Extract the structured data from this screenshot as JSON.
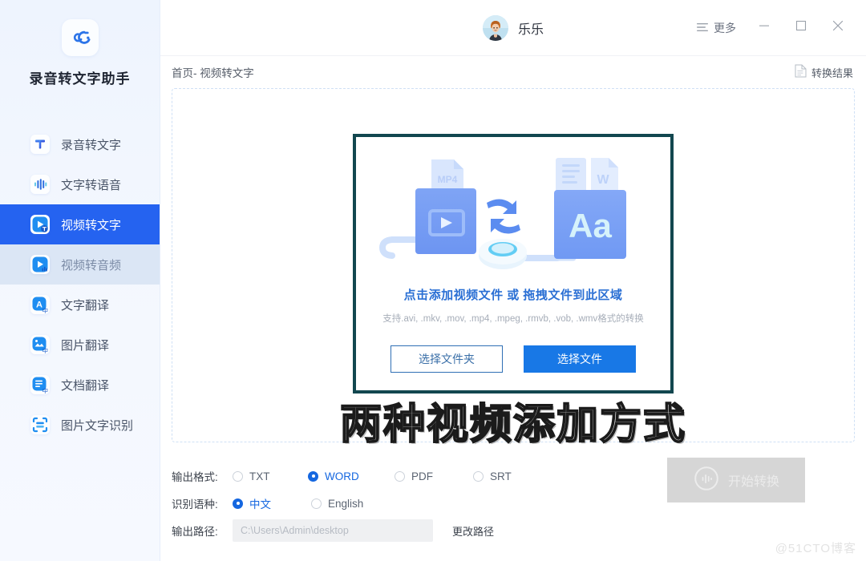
{
  "app": {
    "brand_name": "录音转文字助手",
    "logo_icon": "app-logo-icon"
  },
  "sidebar": {
    "items": [
      {
        "label": "录音转文字",
        "icon": "audio-to-text-icon",
        "state": "normal"
      },
      {
        "label": "文字转语音",
        "icon": "text-to-speech-icon",
        "state": "normal"
      },
      {
        "label": "视频转文字",
        "icon": "video-to-text-icon",
        "state": "selected"
      },
      {
        "label": "视频转音频",
        "icon": "video-to-audio-icon",
        "state": "hovered"
      },
      {
        "label": "文字翻译",
        "icon": "text-translate-icon",
        "state": "normal"
      },
      {
        "label": "图片翻译",
        "icon": "image-translate-icon",
        "state": "normal"
      },
      {
        "label": "文档翻译",
        "icon": "doc-translate-icon",
        "state": "normal"
      },
      {
        "label": "图片文字识别",
        "icon": "ocr-icon",
        "state": "normal"
      }
    ]
  },
  "titlebar": {
    "user_name": "乐乐",
    "more_label": "更多",
    "more_icon": "hamburger-icon",
    "minimize_icon": "minimize-icon",
    "maximize_icon": "maximize-icon",
    "close_icon": "close-icon"
  },
  "breadcrumb": {
    "text": "首页- 视频转文字",
    "result_label": "转换结果",
    "result_icon": "document-icon"
  },
  "dropzone": {
    "title": "点击添加视频文件 或 拖拽文件到此区域",
    "subtitle": "支持.avi, .mkv, .mov, .mp4, .mpeg, .rmvb, .vob, .wmv格式的转换",
    "folder_button": "选择文件夹",
    "file_button": "选择文件",
    "illustration_icon": "video-to-text-illustration",
    "source_file_label": "MP4",
    "target_text_label": "Aa",
    "target_doc_label": "W"
  },
  "overlay_caption": "两种视频添加方式",
  "form": {
    "format_label": "输出格式:",
    "format_options": [
      {
        "label": "TXT",
        "selected": false
      },
      {
        "label": "WORD",
        "selected": true
      },
      {
        "label": "PDF",
        "selected": false
      },
      {
        "label": "SRT",
        "selected": false
      }
    ],
    "language_label": "识别语种:",
    "language_options": [
      {
        "label": "中文",
        "selected": true
      },
      {
        "label": "English",
        "selected": false
      }
    ],
    "path_label": "输出路径:",
    "path_placeholder": "C:\\Users\\Admin\\desktop",
    "path_value": "",
    "change_path_label": "更改路径"
  },
  "start_button": {
    "label": "开始转换",
    "icon": "waveform-circle-icon",
    "disabled": true
  },
  "watermark": "@51CTO博客",
  "colors": {
    "accent": "#1567e0",
    "sidebar_selected": "#2563f0",
    "sidebar_hover": "#dbe6f5",
    "inner_box_border": "#12474f",
    "primary_button": "#1878e6",
    "disabled_button": "#d6d6d6"
  }
}
